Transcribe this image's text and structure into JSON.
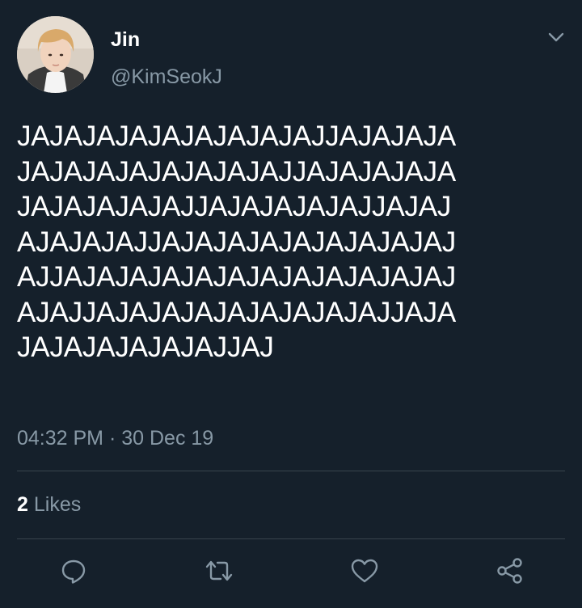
{
  "tweet": {
    "author_name": "Jin",
    "author_handle": "@KimSeokJ",
    "text_lines": [
      "JAJAJAJAJAJAJAJAJAJJAJAJAJA",
      "JAJAJAJAJAJAJAJAJJAJAJAJAJA",
      "JAJAJAJAJAJJAJAJAJAJAJJAJAJ",
      "AJAJAJAJJAJAJAJAJAJAJAJAJAJ",
      "AJJAJAJAJAJAJAJAJAJAJAJAJAJ",
      "AJAJJAJAJAJAJAJAJAJAJAJJAJA",
      "JAJAJAJAJAJAJJAJ"
    ],
    "time": "04:32 PM",
    "separator": "·",
    "date": "30 Dec 19",
    "likes_count": "2",
    "likes_label": "Likes"
  },
  "icons": {
    "menu": "chevron-down-icon",
    "reply": "reply-icon",
    "retweet": "retweet-icon",
    "like": "heart-icon",
    "share": "share-icon"
  },
  "colors": {
    "background": "#15202b",
    "text_primary": "#ffffff",
    "text_secondary": "#8899a6",
    "divider": "#38444d"
  }
}
